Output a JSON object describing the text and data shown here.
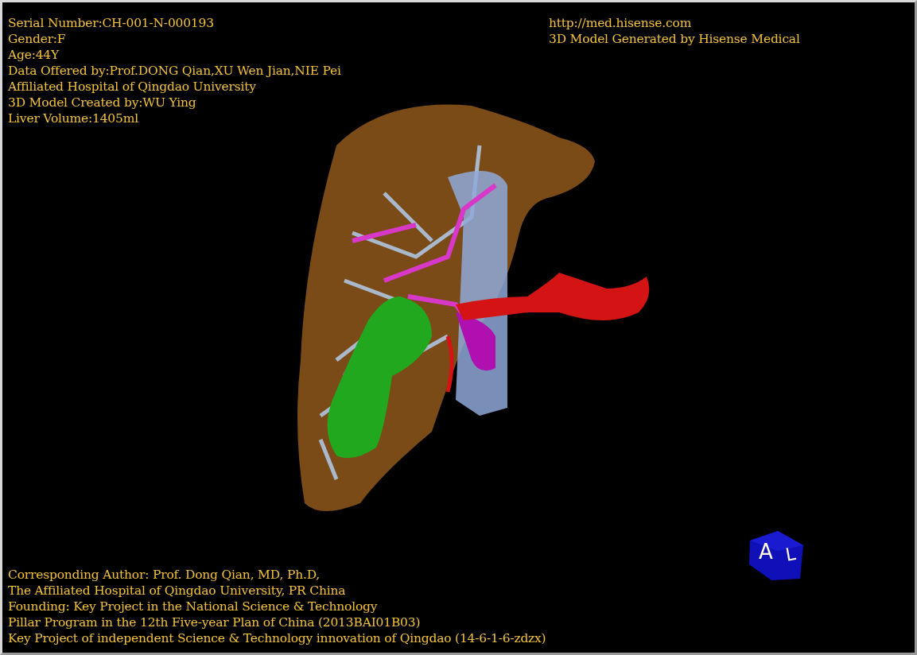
{
  "patient_info": [
    "Serial Number:CH-001-N-000193",
    "Gender:F",
    "Age:44Y",
    "Data Offered by:Prof.DONG Qian,XU Wen Jian,NIE Pei",
    "Affiliated Hospital of Qingdao University",
    "3D Model Created by:WU Ying",
    "Liver Volume:1405ml"
  ],
  "generator_info": [
    "http://med.hisense.com",
    "3D Model Generated by Hisense Medical"
  ],
  "credits": [
    "Corresponding Author: Prof. Dong Qian, MD, Ph.D,",
    "The Affiliated Hospital of Qingdao University, PR China",
    "Founding: Key Project in the National Science & Technology",
    "Pillar Program in the 12th Five-year Plan of China (2013BAI01B03)",
    "Key Project of independent Science & Technology innovation of Qingdao (14-6-1-6-zdzx)"
  ],
  "orientation_cube": {
    "front_label": "A",
    "side_label": "L"
  }
}
